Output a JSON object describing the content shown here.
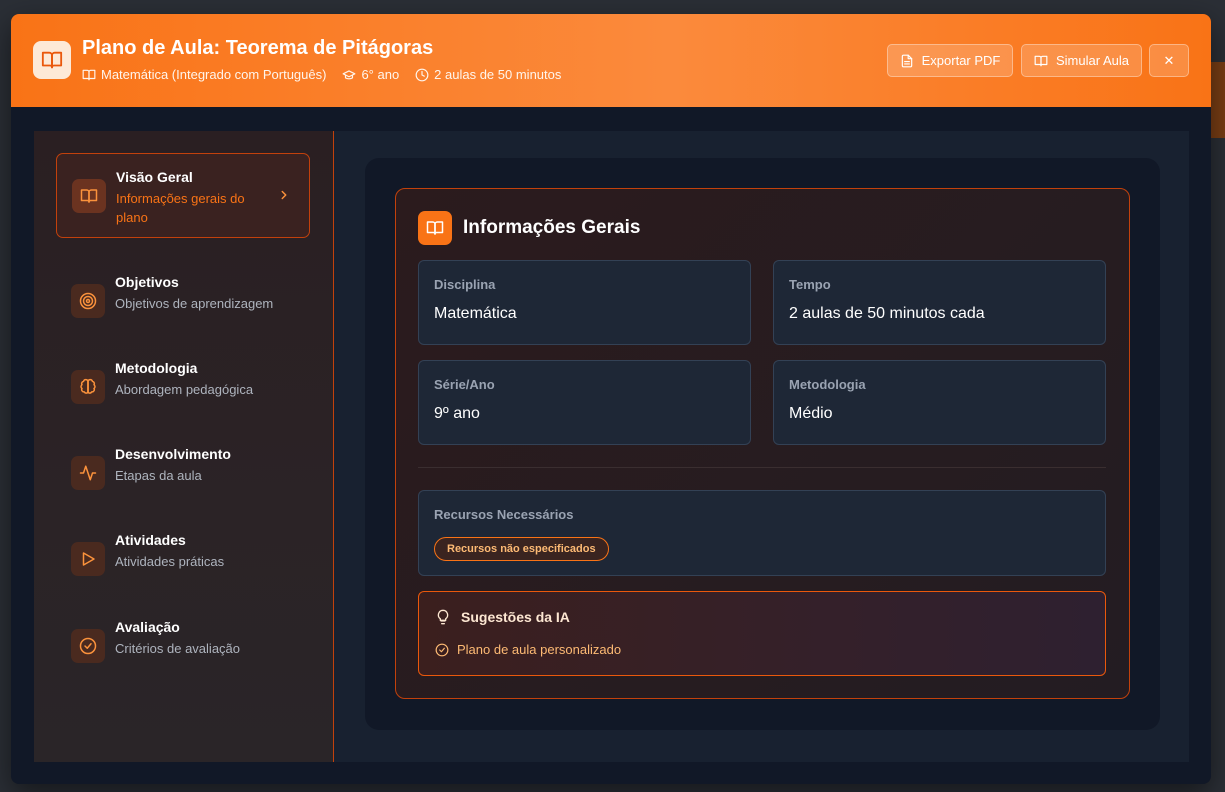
{
  "header": {
    "title": "Plano de Aula: Teorema de Pitágoras",
    "subject": "Matemática (Integrado com Português)",
    "grade": "6° ano",
    "duration": "2 aulas de 50 minutos",
    "export_label": "Exportar PDF",
    "simulate_label": "Simular Aula",
    "close_symbol": "✕",
    "accent": "#f97316"
  },
  "sidebar": {
    "items": [
      {
        "icon": "book-icon",
        "title": "Visão Geral",
        "subtitle": "Informações gerais do plano",
        "active": true
      },
      {
        "icon": "target-icon",
        "title": "Objetivos",
        "subtitle": "Objetivos de aprendizagem"
      },
      {
        "icon": "brain-icon",
        "title": "Metodologia",
        "subtitle": "Abordagem pedagógica"
      },
      {
        "icon": "activity-icon",
        "title": "Desenvolvimento",
        "subtitle": "Etapas da aula"
      },
      {
        "icon": "play-icon",
        "title": "Atividades",
        "subtitle": "Atividades práticas"
      },
      {
        "icon": "check-circle-icon",
        "title": "Avaliação",
        "subtitle": "Critérios de avaliação"
      }
    ]
  },
  "main": {
    "title": "Informações Gerais",
    "fields": [
      {
        "label": "Disciplina",
        "value": "Matemática"
      },
      {
        "label": "Tempo",
        "value": "2 aulas de 50 minutos cada"
      },
      {
        "label": "Série/Ano",
        "value": "9º ano"
      },
      {
        "label": "Metodologia",
        "value": "Médio"
      }
    ],
    "resources": {
      "label": "Recursos Necessários",
      "badge": "Recursos não especificados"
    },
    "ai": {
      "title": "Sugestões da IA",
      "item": "Plano de aula personalizado"
    }
  }
}
